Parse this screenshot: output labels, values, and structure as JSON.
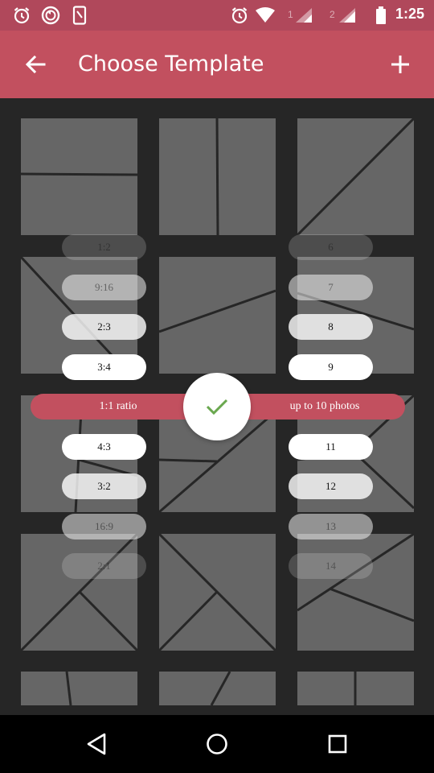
{
  "status_bar": {
    "time": "1:25",
    "sim1": "1",
    "sim2": "2",
    "icons": [
      "alarm-icon",
      "sync-icon",
      "phone-icon",
      "alarm-icon",
      "wifi-icon",
      "signal-icon",
      "signal-icon",
      "battery-icon"
    ]
  },
  "app_bar": {
    "title": "Choose Template",
    "back_icon": "arrow-back-icon",
    "add_icon": "plus-icon"
  },
  "ratio_picker": {
    "options": [
      "1:2",
      "9:16",
      "2:3",
      "3:4",
      "1:1 ratio",
      "4:3",
      "3:2",
      "16:9",
      "2:1"
    ],
    "selected_label": "1:1 ratio"
  },
  "photo_count_picker": {
    "options": [
      "6",
      "7",
      "8",
      "9",
      "up to 10 photos",
      "11",
      "12",
      "13",
      "14"
    ],
    "selected_label": "up to 10 photos"
  },
  "confirm_icon": "checkmark-icon",
  "colors": {
    "accent": "#C2505F",
    "status_bar": "#B0485B",
    "background": "#262626",
    "tile": "#666666",
    "check": "#6AA84F"
  },
  "nav_bar": {
    "icons": [
      "back-triangle-icon",
      "home-circle-icon",
      "recents-square-icon"
    ]
  }
}
